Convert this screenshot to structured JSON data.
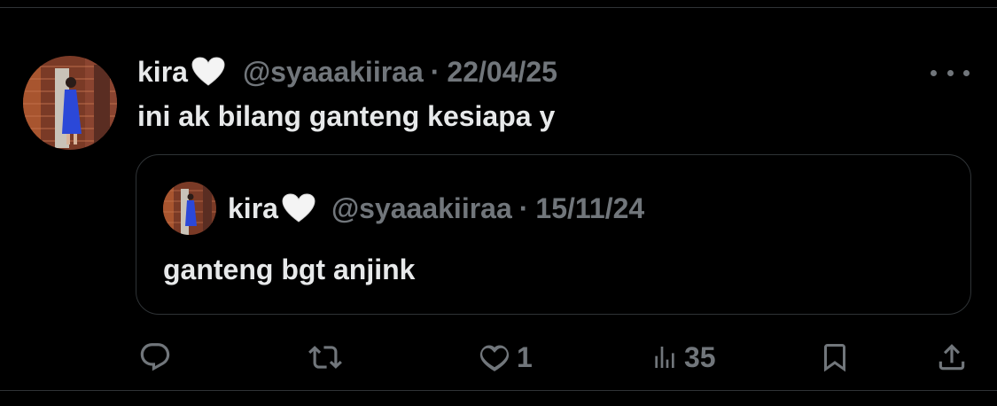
{
  "tweet": {
    "display_name": "kira",
    "handle": "@syaaakiiraa",
    "separator": "·",
    "date": "22/04/25",
    "text": "ini ak bilang ganteng kesiapa y",
    "quoted": {
      "display_name": "kira",
      "handle": "@syaaakiiraa",
      "separator": "·",
      "date": "15/11/24",
      "text": "ganteng bgt anjink"
    }
  },
  "actions": {
    "reply_icon": "reply-icon",
    "retweet_icon": "retweet-icon",
    "like_icon": "heart-icon",
    "like_count": "1",
    "views_icon": "views-icon",
    "view_count": "35",
    "bookmark_icon": "bookmark-icon",
    "share_icon": "share-icon"
  },
  "colors": {
    "background": "#000000",
    "primary_text": "#e7e9ea",
    "secondary_text": "#71767b",
    "border": "#2f3336"
  }
}
